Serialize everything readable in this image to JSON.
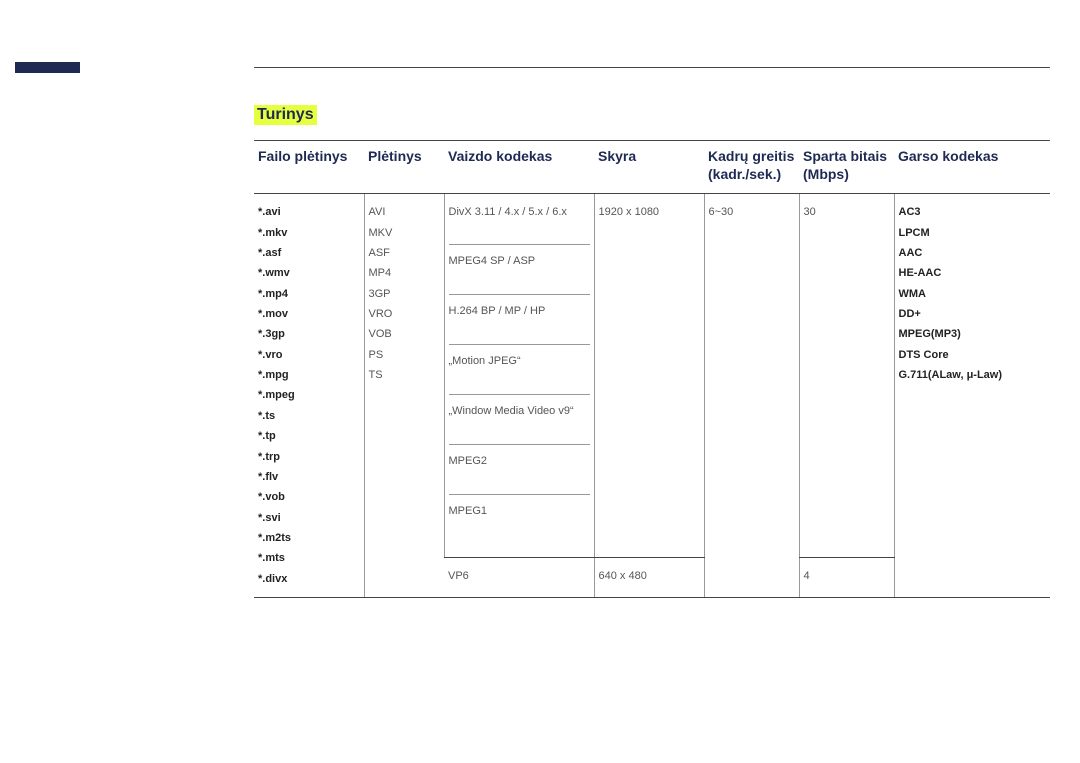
{
  "heading": "Turinys",
  "headers": {
    "file_ext": "Failo plėtinys",
    "container": "Plėtinys",
    "vcodec": "Vaizdo kodekas",
    "resolution": "Skyra",
    "fps": "Kadrų greitis (kadr./sek.)",
    "bps": "Sparta bitais (Mbps)",
    "acodec": "Garso kodekas"
  },
  "file_exts": [
    "*.avi",
    "*.mkv",
    "*.asf",
    "*.wmv",
    "*.mp4",
    "*.mov",
    "*.3gp",
    "*.vro",
    "*.mpg",
    "*.mpeg",
    "*.ts",
    "*.tp",
    "*.trp",
    "*.flv",
    "*.vob",
    "*.svi",
    "*.m2ts",
    "*.mts",
    "*.divx"
  ],
  "containers": [
    "AVI",
    "MKV",
    "ASF",
    "MP4",
    "3GP",
    "VRO",
    "VOB",
    "PS",
    "TS"
  ],
  "vcodecs_main": [
    "DivX 3.11 / 4.x / 5.x / 6.x",
    "MPEG4 SP / ASP",
    "H.264 BP / MP / HP",
    "„Motion JPEG“",
    "„Window Media Video v9“",
    "MPEG2",
    "MPEG1"
  ],
  "vcodec_vp6": "VP6",
  "res_main": "1920 x 1080",
  "res_vp6": "640 x 480",
  "fps_main": "6~30",
  "bps_main": "30",
  "bps_vp6": "4",
  "acodecs": [
    "AC3",
    "LPCM",
    "AAC",
    "HE-AAC",
    "WMA",
    "DD+",
    "MPEG(MP3)",
    "DTS Core",
    "G.711(ALaw, μ-Law)"
  ]
}
